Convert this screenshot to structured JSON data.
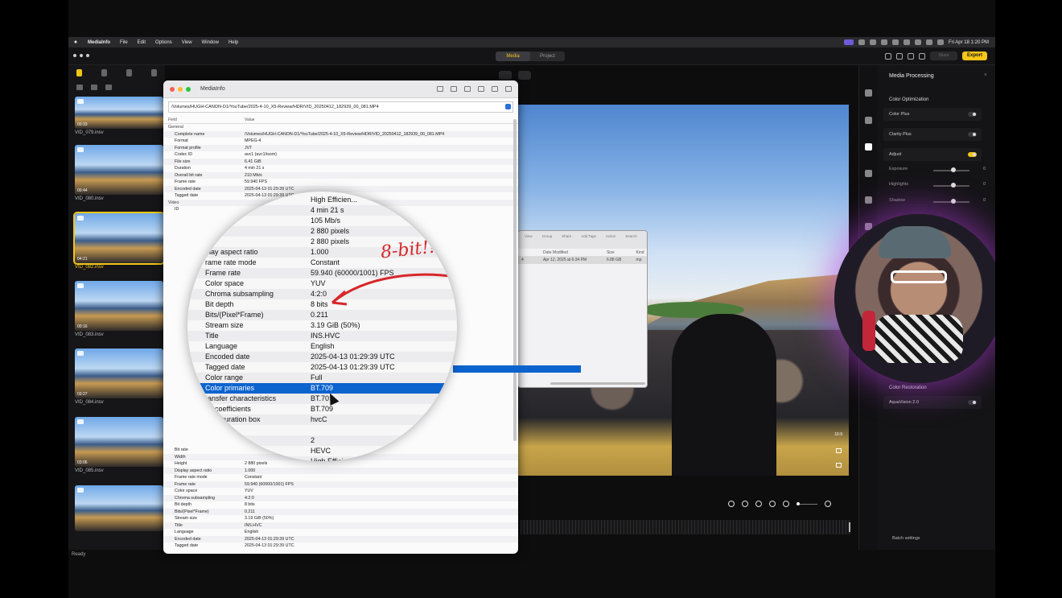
{
  "menubar": {
    "app": "MediaInfo",
    "items": [
      "File",
      "Edit",
      "Options",
      "View",
      "Window",
      "Help"
    ],
    "clock": "Fri Apr 18  1:20 PM"
  },
  "appbar": {
    "tabs": [
      "Media",
      "Project"
    ],
    "active_tab": "Media",
    "share_label": "Share",
    "export_label": "Export",
    "accent": "#f0c419"
  },
  "sidebar": {
    "clips": [
      {
        "name": "VID_079.insv",
        "duration": "00:33"
      },
      {
        "name": "VID_080.insv",
        "duration": "00:44"
      },
      {
        "name": "VID_082.insv",
        "duration": "04:21",
        "selected": true
      },
      {
        "name": "VID_083.insv",
        "duration": "00:16"
      },
      {
        "name": "VID_084.insv",
        "duration": "03:27"
      },
      {
        "name": "VID_085.insv",
        "duration": "03:06"
      }
    ],
    "status": "Ready"
  },
  "mediainfo": {
    "window_title": "MediaInfo",
    "path": "/Volumes/HUGH-CANON-D1/YouTube/2025-4-10_X5-Review/HDR/VID_20250412_182939_00_081.MP4",
    "header_field": "Field",
    "header_value": "Value",
    "rows": [
      {
        "k": "General",
        "v": "",
        "group": true
      },
      {
        "k": "Complete name",
        "v": "/Volumes/HUGH-CANON-D1/YouTube/2025-4-10_X5-Review/HDR/VID_20250412_182939_00_081.MP4"
      },
      {
        "k": "Format",
        "v": "MPEG-4"
      },
      {
        "k": "Format profile",
        "v": "JVT"
      },
      {
        "k": "Codec ID",
        "v": "avc1 (avc1/isom)"
      },
      {
        "k": "File size",
        "v": "6.41 GiB"
      },
      {
        "k": "Duration",
        "v": "4 min 21 s"
      },
      {
        "k": "Overall bit rate",
        "v": "210 Mb/s"
      },
      {
        "k": "Frame rate",
        "v": "59.940 FPS"
      },
      {
        "k": "Encoded date",
        "v": "2025-04-13 01:29:39 UTC"
      },
      {
        "k": "Tagged date",
        "v": "2025-04-13 01:29:39 UTC"
      },
      {
        "k": "Video",
        "v": "",
        "group": true
      },
      {
        "k": "ID",
        "v": ""
      }
    ],
    "rows_bottom": [
      {
        "k": "Bit rate",
        "v": ""
      },
      {
        "k": "Width",
        "v": ""
      },
      {
        "k": "Height",
        "v": "2 880 pixels"
      },
      {
        "k": "Display aspect ratio",
        "v": "1.000"
      },
      {
        "k": "Frame rate mode",
        "v": "Constant"
      },
      {
        "k": "Frame rate",
        "v": "59.940 (60000/1001) FPS"
      },
      {
        "k": "Color space",
        "v": "YUV"
      },
      {
        "k": "Chroma subsampling",
        "v": "4:2:0"
      },
      {
        "k": "Bit depth",
        "v": "8 bits"
      },
      {
        "k": "Bits/(Pixel*Frame)",
        "v": "0.211"
      },
      {
        "k": "Stream size",
        "v": "3.19 GiB (50%)"
      },
      {
        "k": "Title",
        "v": "INS.HVC"
      },
      {
        "k": "Language",
        "v": "English"
      },
      {
        "k": "Encoded date",
        "v": "2025-04-13 01:29:39 UTC"
      },
      {
        "k": "Tagged date",
        "v": "2025-04-13 01:29:39 UTC"
      }
    ]
  },
  "magnifier": {
    "annotation": "8-bit!!",
    "rows": [
      {
        "k": "",
        "v": "High Efficien..."
      },
      {
        "k": "",
        "v": "4 min 21 s"
      },
      {
        "k": "",
        "v": "105 Mb/s"
      },
      {
        "k": "",
        "v": "2 880 pixels"
      },
      {
        "k": "",
        "v": "2 880 pixels"
      },
      {
        "k": "play aspect ratio",
        "v": "1.000"
      },
      {
        "k": "rame rate mode",
        "v": "Constant"
      },
      {
        "k": "Frame rate",
        "v": "59.940 (60000/1001) FPS"
      },
      {
        "k": "Color space",
        "v": "YUV"
      },
      {
        "k": "Chroma subsampling",
        "v": "4:2:0"
      },
      {
        "k": "Bit depth",
        "v": "8 bits"
      },
      {
        "k": "Bits/(Pixel*Frame)",
        "v": "0.211"
      },
      {
        "k": "Stream size",
        "v": "3.19 GiB (50%)"
      },
      {
        "k": "Title",
        "v": "INS.HVC"
      },
      {
        "k": "Language",
        "v": "English"
      },
      {
        "k": "Encoded date",
        "v": "2025-04-13 01:29:39 UTC"
      },
      {
        "k": "Tagged date",
        "v": "2025-04-13 01:29:39 UTC"
      },
      {
        "k": "Color range",
        "v": "Full"
      },
      {
        "k": "Color primaries",
        "v": "BT.709",
        "selected": true
      },
      {
        "k": "ransfer characteristics",
        "v": "BT.70"
      },
      {
        "k": "rix coefficients",
        "v": "BT.709"
      },
      {
        "k": "configuration box",
        "v": "hvcC"
      },
      {
        "k": "",
        "v": ""
      },
      {
        "k": "",
        "v": "2"
      },
      {
        "k": "",
        "v": "HEVC"
      },
      {
        "k": "",
        "v": "High Efficienc..."
      }
    ]
  },
  "finder": {
    "toolbar": [
      "View",
      "Group",
      "Share",
      "Add Tags",
      "Action",
      "Search"
    ],
    "headers": [
      "",
      "Date Modified",
      "Size",
      "Kind"
    ],
    "row": [
      "4",
      "Apr 12, 2025 at 6:34 PM",
      "6.88 GB",
      "mp"
    ]
  },
  "preview": {
    "ratio": "16:9"
  },
  "rpanel": {
    "title": "Media Processing",
    "section_opt": "Color Optimization",
    "color_plus": "Color Plus",
    "clarity_plus": "Clarity Plus",
    "adjust": "Adjust",
    "sliders": [
      {
        "label": "Exposure",
        "value": "0"
      },
      {
        "label": "Highlights",
        "value": "0"
      },
      {
        "label": "Shadow",
        "value": "0"
      }
    ],
    "section_restore": "Color Restoration",
    "aquavision": "AquaVision 2.0",
    "batch": "Batch settings"
  }
}
